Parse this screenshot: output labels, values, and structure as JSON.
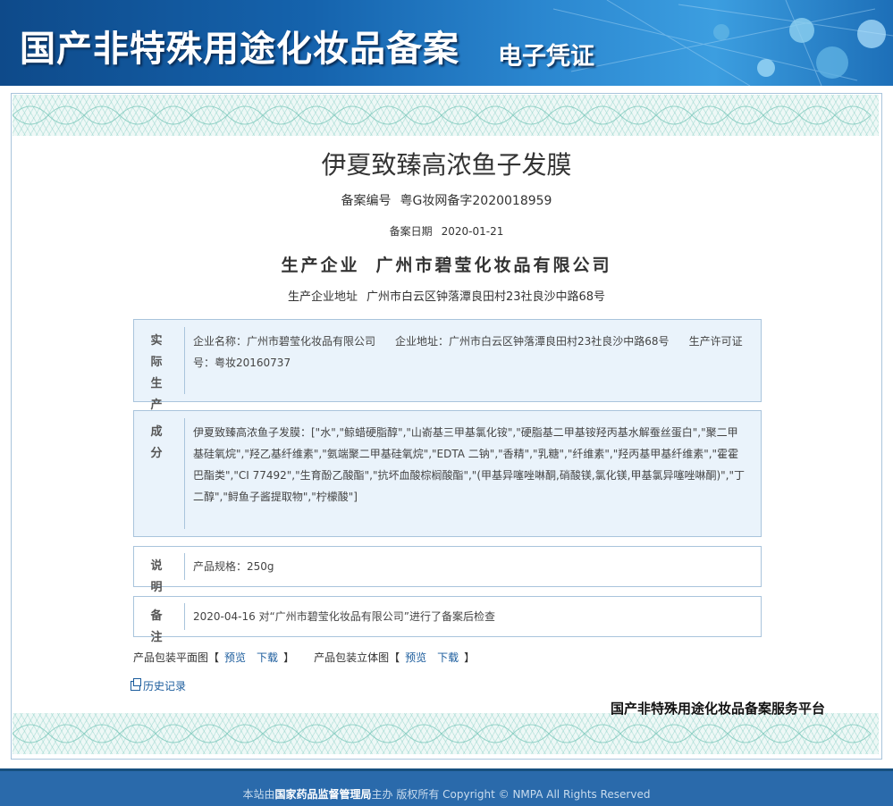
{
  "header": {
    "title": "国产非特殊用途化妆品备案",
    "subtitle": "电子凭证"
  },
  "product": {
    "name": "伊夏致臻高浓鱼子发膜",
    "reg_label": "备案编号",
    "reg_value": "粤G妆网备字2020018959",
    "date_label": "备案日期",
    "date_value": "2020-01-21",
    "company_label": "生产企业",
    "company_value": "广州市碧莹化妆品有限公司",
    "address_label": "生产企业地址",
    "address_value": "广州市白云区钟落潭良田村23社良沙中路68号"
  },
  "sections": {
    "actual": {
      "head": "实际生产企业",
      "name": "企业名称：广州市碧莹化妆品有限公司",
      "address": "企业地址：广州市白云区钟落潭良田村23社良沙中路68号",
      "license": "生产许可证号：粤妆20160737"
    },
    "ingredients": {
      "head": "成分",
      "text": "伊夏致臻高浓鱼子发膜：[\"水\",\"鲸蜡硬脂醇\",\"山嵛基三甲基氯化铵\",\"硬脂基二甲基铵羟丙基水解蚕丝蛋白\",\"聚二甲基硅氧烷\",\"羟乙基纤维素\",\"氨端聚二甲基硅氧烷\",\"EDTA 二钠\",\"香精\",\"乳糖\",\"纤维素\",\"羟丙基甲基纤维素\",\"霍霍巴酯类\",\"CI 77492\",\"生育酚乙酸酯\",\"抗坏血酸棕榈酸酯\",\"(甲基异噻唑啉酮,硝酸镁,氯化镁,甲基氯异噻唑啉酮)\",\"丁二醇\",\"鲟鱼子酱提取物\",\"柠檬酸\"]"
    },
    "description": {
      "head": "说明",
      "text": "产品规格：250g"
    },
    "remarks": {
      "head": "备注",
      "text": "2020-04-16 对“广州市碧莹化妆品有限公司”进行了备案后检查"
    }
  },
  "downloads": {
    "flat_label": "产品包装平面图",
    "stereo_label": "产品包装立体图",
    "preview": "预览",
    "download": "下载",
    "bracket_open": "【",
    "bracket_close": "】"
  },
  "history": "历史记录",
  "platform": "国产非特殊用途化妆品备案服务平台",
  "footer": {
    "prefix": "本站由",
    "org": "国家药品监督管理局",
    "suffix": "主办 版权所有 Copyright © NMPA All Rights Reserved"
  },
  "colors": {
    "header_blue": "#1563ad",
    "link_blue": "#1a5b9c",
    "box_blue": "#eaf3fb",
    "footer_blue": "#2a6aab"
  }
}
